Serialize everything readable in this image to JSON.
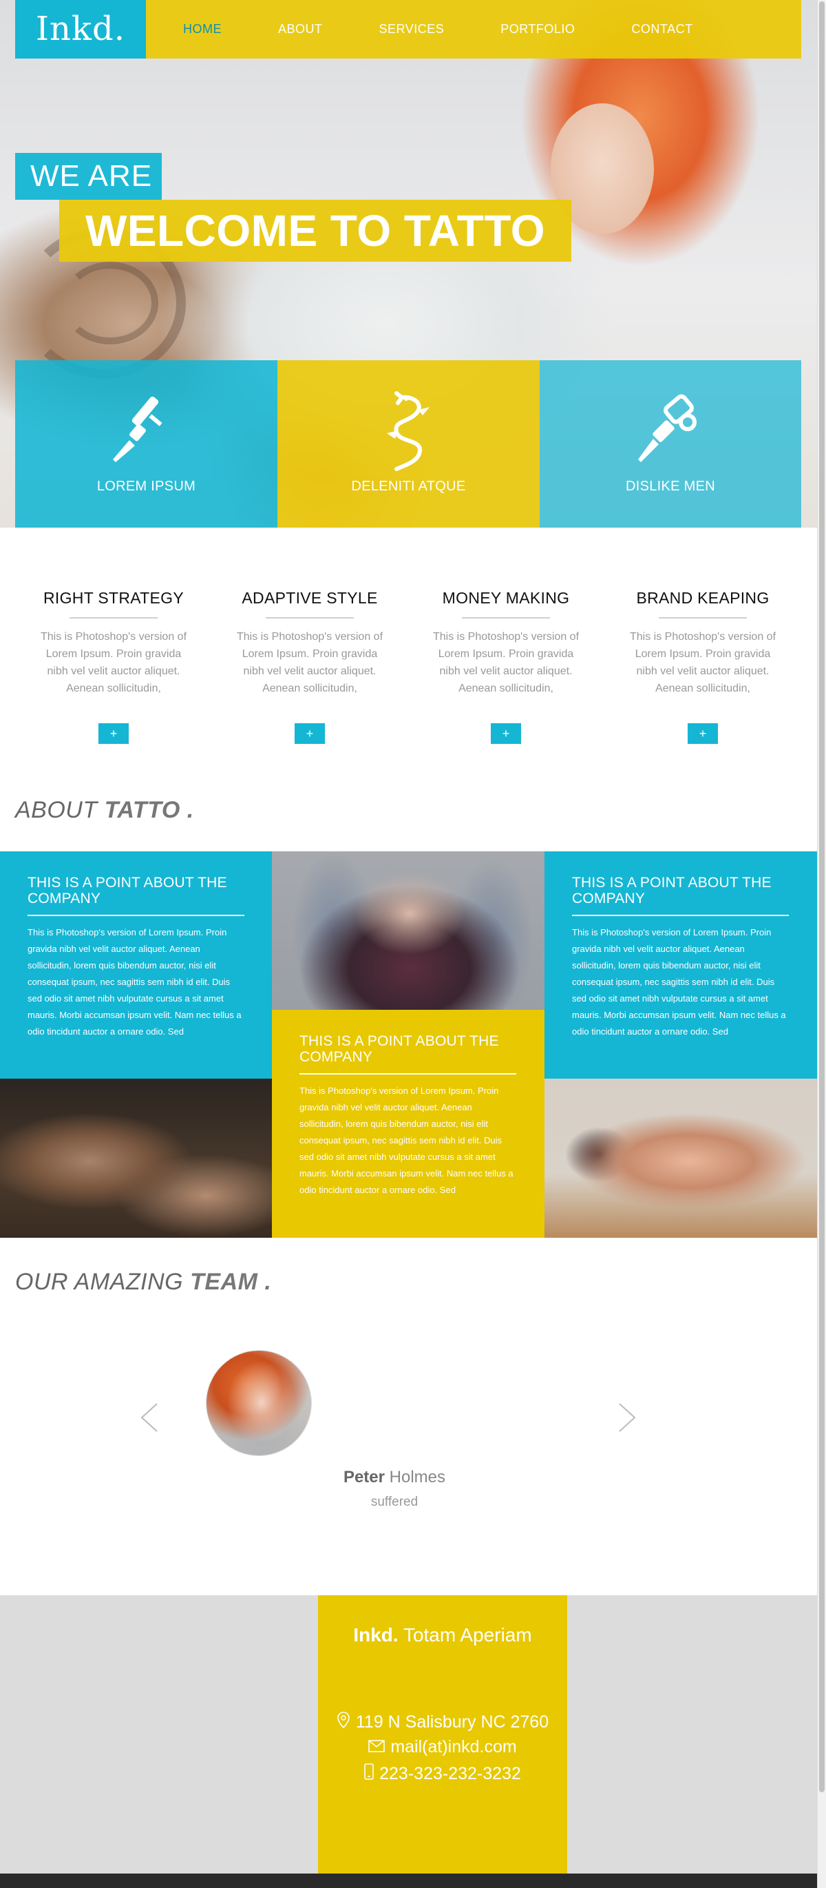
{
  "brand": {
    "logo": "Inkd."
  },
  "nav": {
    "items": [
      "HOME",
      "ABOUT",
      "SERVICES",
      "PORTFOLIO",
      "CONTACT"
    ],
    "active": "HOME"
  },
  "hero": {
    "we_are": "WE ARE",
    "welcome": "WELCOME TO TATTO"
  },
  "features": [
    {
      "label": "LOREM IPSUM",
      "icon": "tattoo-machine-icon"
    },
    {
      "label": "DELENITI ATQUE",
      "icon": "dragon-icon"
    },
    {
      "label": "DISLIKE MEN",
      "icon": "tattoo-gun-icon"
    }
  ],
  "services": [
    {
      "title": "RIGHT STRATEGY",
      "text": "This is Photoshop's version of Lorem Ipsum. Proin gravida nibh vel velit auctor aliquet. Aenean sollicitudin,",
      "button": "+"
    },
    {
      "title": "ADAPTIVE STYLE",
      "text": "This is Photoshop's version of Lorem Ipsum. Proin gravida nibh vel velit auctor aliquet. Aenean sollicitudin,",
      "button": "+"
    },
    {
      "title": "MONEY MAKING",
      "text": "This is Photoshop's version of Lorem Ipsum. Proin gravida nibh vel velit auctor aliquet. Aenean sollicitudin,",
      "button": "+"
    },
    {
      "title": "BRAND KEAPING",
      "text": "This is Photoshop's version of Lorem Ipsum. Proin gravida nibh vel velit auctor aliquet. Aenean sollicitudin,",
      "button": "+"
    }
  ],
  "about": {
    "title_light": "ABOUT",
    "title_bold": "TATTO .",
    "points": [
      {
        "title": "THIS IS A POINT ABOUT THE COMPANY",
        "text": "This is Photoshop's version of Lorem Ipsum. Proin gravida nibh vel velit auctor aliquet. Aenean sollicitudin, lorem quis bibendum auctor, nisi elit consequat ipsum, nec sagittis sem nibh id elit. Duis sed odio sit amet nibh vulputate cursus a sit amet mauris. Morbi accumsan ipsum velit. Nam nec tellus a odio tincidunt auctor a ornare odio. Sed"
      },
      {
        "title": "THIS IS A POINT ABOUT THE COMPANY",
        "text": "This is Photoshop's version of Lorem Ipsum. Proin gravida nibh vel velit auctor aliquet. Aenean sollicitudin, lorem quis bibendum auctor, nisi elit consequat ipsum, nec sagittis sem nibh id elit. Duis sed odio sit amet nibh vulputate cursus a sit amet mauris. Morbi accumsan ipsum velit. Nam nec tellus a odio tincidunt auctor a ornare odio. Sed"
      },
      {
        "title": "THIS IS A POINT ABOUT THE COMPANY",
        "text": "This is Photoshop's version of Lorem Ipsum. Proin gravida nibh vel velit auctor aliquet. Aenean sollicitudin, lorem quis bibendum auctor, nisi elit consequat ipsum, nec sagittis sem nibh id elit. Duis sed odio sit amet nibh vulputate cursus a sit amet mauris. Morbi accumsan ipsum velit. Nam nec tellus a odio tincidunt auctor a ornare odio. Sed"
      }
    ]
  },
  "team": {
    "title_light": "OUR AMAZING",
    "title_bold": "TEAM .",
    "member": {
      "first_name": "Peter",
      "last_name": "Holmes",
      "role": "suffered"
    }
  },
  "footer": {
    "brand": "Inkd.",
    "tagline": "Totam Aperiam",
    "address": "119 N Salisbury NC 2760",
    "email": "mail(at)inkd.com",
    "phone": "223-323-232-3232"
  },
  "colors": {
    "cyan": "#14b6d4",
    "yellow": "#e8c800",
    "footer_bg": "#dcdcdc"
  }
}
